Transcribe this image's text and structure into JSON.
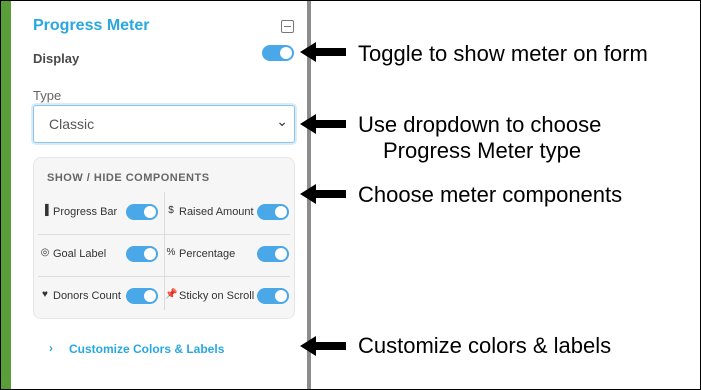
{
  "panel": {
    "title": "Progress Meter",
    "collapse_icon": "minus-square-icon",
    "display_label": "Display",
    "display_enabled": true,
    "type_label": "Type",
    "type_value": "Classic",
    "components_title": "SHOW / HIDE COMPONENTS",
    "components": [
      {
        "icon": "progress-bar-icon",
        "glyph": "▐",
        "label": "Progress Bar",
        "enabled": true
      },
      {
        "icon": "dollar-icon",
        "glyph": "$",
        "label": "Raised Amount",
        "enabled": true
      },
      {
        "icon": "target-icon",
        "glyph": "◎",
        "label": "Goal Label",
        "enabled": true
      },
      {
        "icon": "percent-icon",
        "glyph": "%",
        "label": "Percentage",
        "enabled": true
      },
      {
        "icon": "heart-icon",
        "glyph": "♥",
        "label": "Donors Count",
        "enabled": true
      },
      {
        "icon": "pin-icon",
        "glyph": "📌",
        "label": "Sticky on Scroll",
        "enabled": true
      }
    ],
    "customize_label": "Customize Colors & Labels"
  },
  "callouts": {
    "toggle": "Toggle to show meter on form",
    "dropdown_line1": "Use dropdown to choose",
    "dropdown_line2": "Progress Meter type",
    "components": "Choose meter components",
    "customize": "Customize colors & labels"
  },
  "colors": {
    "accent": "#29a8e0",
    "toggle_on": "#4aa8e8",
    "side_bar": "#5a9e3a"
  }
}
